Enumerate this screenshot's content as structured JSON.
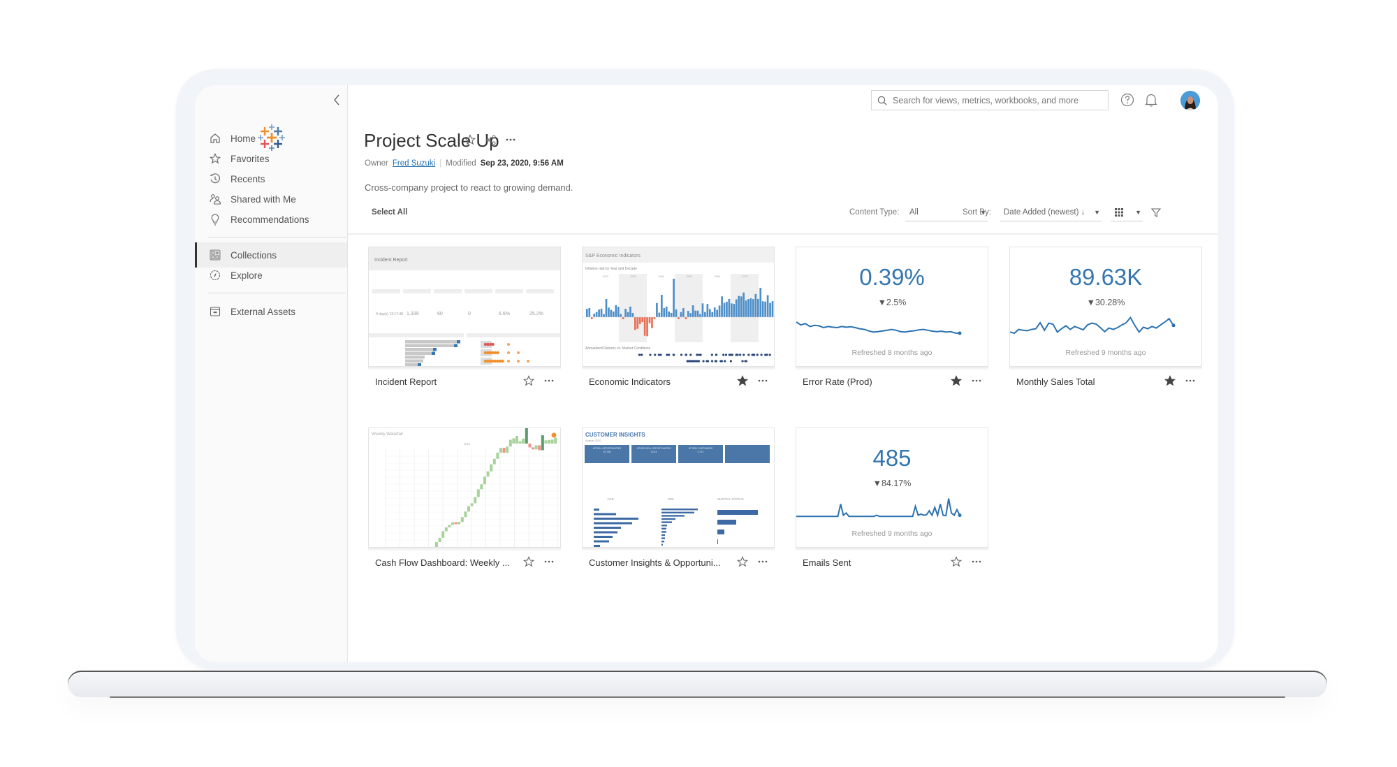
{
  "sidebar": {
    "collapse_label": "‹",
    "logo": "tableau-logo",
    "items": [
      {
        "label": "Home",
        "icon": "home-icon"
      },
      {
        "label": "Favorites",
        "icon": "star-icon"
      },
      {
        "label": "Recents",
        "icon": "clock-icon"
      },
      {
        "label": "Shared with Me",
        "icon": "shared-users-icon"
      },
      {
        "label": "Recommendations",
        "icon": "lightbulb-icon"
      },
      {
        "label": "Collections",
        "icon": "collections-icon",
        "active": true
      },
      {
        "label": "Explore",
        "icon": "compass-icon"
      },
      {
        "label": "External Assets",
        "icon": "external-assets-icon"
      }
    ]
  },
  "header": {
    "search_placeholder": "Search for views, metrics, workbooks, and more",
    "help_icon": "help-icon",
    "notifications_icon": "bell-icon",
    "avatar": "user-avatar"
  },
  "collection": {
    "title": "Project Scale Up",
    "owner_label": "Owner",
    "owner_name": "Fred Suzuki",
    "modified_label": "Modified",
    "modified_value": "Sep 23, 2020, 9:56 AM",
    "description": "Cross-company project to react to growing demand."
  },
  "toolbar": {
    "select_all": "Select All",
    "content_type_label": "Content Type:",
    "content_type_value": "All",
    "sort_by_label": "Sort By:",
    "sort_by_value": "Date Added (newest) ↓",
    "view_mode": "grid-icon"
  },
  "cards": [
    {
      "title": "Incident Report",
      "type": "view",
      "favorited": false,
      "thumb": {
        "heading": "Incident Report",
        "kpis": [
          "9 day(s) 12:17:48",
          "1,339",
          "60",
          "0",
          "6.6%",
          "25.2%"
        ]
      }
    },
    {
      "title": "Economic Indicators",
      "type": "view",
      "favorited": true,
      "thumb": {
        "heading": "S&P Economic Indicators",
        "subheading": "Inflation rate by Year and Decade",
        "decades": [
          "1920",
          "1930",
          "1940",
          "1950",
          "1960",
          "1970"
        ],
        "footer": "Annualized Returns vs. Market Conditions"
      }
    },
    {
      "title": "Error Rate (Prod)",
      "type": "metric",
      "favorited": true,
      "value": "0.39%",
      "change": "▼2.5%",
      "refreshed": "Refreshed 8 months ago",
      "spark": [
        0.75,
        0.62,
        0.68,
        0.55,
        0.6,
        0.58,
        0.5,
        0.55,
        0.52,
        0.5,
        0.55,
        0.52,
        0.54,
        0.5,
        0.45,
        0.42,
        0.35,
        0.3,
        0.32,
        0.35,
        0.38,
        0.42,
        0.38,
        0.32,
        0.3,
        0.34,
        0.36,
        0.4,
        0.42,
        0.38,
        0.34,
        0.32,
        0.34,
        0.3,
        0.32,
        0.26,
        0.25
      ]
    },
    {
      "title": "Monthly Sales Total",
      "type": "metric",
      "favorited": true,
      "value": "89.63K",
      "change": "▼30.28%",
      "refreshed": "Refreshed 9 months ago",
      "spark": [
        0.3,
        0.25,
        0.42,
        0.38,
        0.36,
        0.42,
        0.45,
        0.72,
        0.38,
        0.7,
        0.65,
        0.3,
        0.45,
        0.58,
        0.42,
        0.55,
        0.48,
        0.4,
        0.62,
        0.7,
        0.66,
        0.5,
        0.32,
        0.48,
        0.42,
        0.5,
        0.62,
        0.72,
        0.95,
        0.6,
        0.3,
        0.52,
        0.45,
        0.55,
        0.48,
        0.62,
        0.75,
        0.9,
        0.6
      ]
    },
    {
      "title": "Cash Flow Dashboard: Weekly ...",
      "type": "view",
      "favorited": false,
      "thumb": {
        "heading": "Weekly Waterfall",
        "year": "2016"
      }
    },
    {
      "title": "Customer Insights & Opportuni...",
      "type": "view",
      "favorited": false,
      "thumb": {
        "heading": "CUSTOMER INSIGHTS",
        "subheading": "August 2020",
        "tiles": [
          {
            "label": "UPSELL OPPORTUNITIES",
            "value": "20,765"
          },
          {
            "label": "CROSS-SELL OPPORTUNITIES",
            "value": "3,013"
          },
          {
            "label": "AT RISK CUSTOMERS",
            "value": "3,741"
          }
        ],
        "sections": [
          "AGE",
          "JOB",
          "MARITAL STATUS"
        ]
      }
    },
    {
      "title": "Emails Sent",
      "type": "metric",
      "favorited": false,
      "value": "485",
      "change": "▼84.17%",
      "refreshed": "Refreshed 9 months ago",
      "spark": [
        0.15,
        0.15,
        0.15,
        0.15,
        0.15,
        0.15,
        0.15,
        0.15,
        0.15,
        0.15,
        0.15,
        0.15,
        0.15,
        0.15,
        0.15,
        0.15,
        0.7,
        0.2,
        0.3,
        0.15,
        0.15,
        0.15,
        0.15,
        0.15,
        0.15,
        0.15,
        0.15,
        0.15,
        0.15,
        0.2,
        0.15,
        0.15,
        0.15,
        0.15,
        0.15,
        0.15,
        0.15,
        0.15,
        0.15,
        0.15,
        0.15,
        0.15,
        0.15,
        0.6,
        0.2,
        0.25,
        0.2,
        0.22,
        0.4,
        0.2,
        0.55,
        0.2,
        0.7,
        0.2,
        0.18,
        0.95,
        0.3,
        0.2,
        0.45,
        0.2
      ]
    }
  ]
}
